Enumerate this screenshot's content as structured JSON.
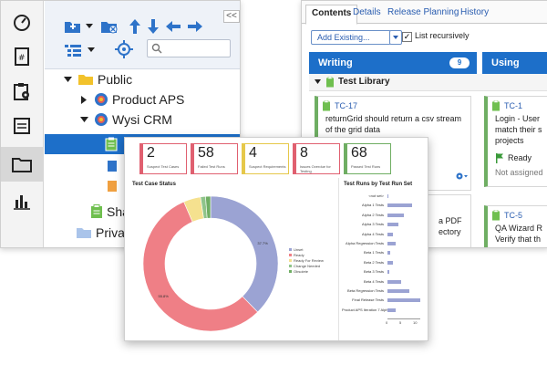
{
  "tree": {
    "collapse": "<<",
    "items": [
      {
        "label": "Public"
      },
      {
        "label": "Product APS"
      },
      {
        "label": "Wysi CRM"
      },
      {
        "label": ""
      },
      {
        "label": ""
      },
      {
        "label": ""
      },
      {
        "label": "Sha"
      },
      {
        "label": "Private"
      }
    ]
  },
  "rail": {
    "icons": [
      "dashboard-icon",
      "requirements-icon",
      "settings-clipboard-icon",
      "test-list-icon",
      "folder-icon",
      "reports-icon"
    ]
  },
  "right": {
    "tabs": [
      "Contents",
      "Details",
      "Release Planning",
      "History"
    ],
    "add_existing": "Add Existing...",
    "list_recursively": "List recursively",
    "columns": [
      {
        "name": "Writing",
        "count": "9"
      },
      {
        "name": "Using"
      }
    ],
    "library": "Test Library",
    "cards": [
      {
        "id": "TC-17",
        "text": [
          "returnGrid should return a csv stream",
          "of the grid data"
        ]
      },
      {
        "id": "TC-1",
        "text": [
          "Login - User",
          "match their s",
          "projects"
        ],
        "status": "Ready",
        "assignee": "Not assigned"
      },
      {
        "id": "",
        "text": [
          "a PDF",
          "ectory"
        ]
      },
      {
        "id": "TC-5",
        "text": [
          "QA Wizard R",
          "Verify that th"
        ]
      }
    ]
  },
  "dash": {
    "stats": [
      {
        "num": "2",
        "cap": "Suspect Test Cases",
        "color": "#e06070"
      },
      {
        "num": "58",
        "cap": "Failed Test Runs",
        "color": "#e06070"
      },
      {
        "num": "4",
        "cap": "Suspect Requirements",
        "color": "#e6c84a"
      },
      {
        "num": "8",
        "cap": "Issues Overdue for Testing",
        "color": "#e06070"
      },
      {
        "num": "68",
        "cap": "Passed Test Runs",
        "color": "#6fae63"
      }
    ],
    "status_title": "Test Case Status",
    "runs_title": "Test Runs by Test Run Set"
  },
  "chart_data": [
    {
      "type": "pie",
      "title": "Test Case Status",
      "categories": [
        "Unset",
        "Ready",
        "Ready For Review",
        "Change Needed",
        "Obsolete"
      ],
      "values": [
        37.7,
        55.8,
        4.1,
        1.2,
        1.2
      ],
      "colors": [
        "#9ba3d3",
        "#ef7f86",
        "#f5e18f",
        "#8fc48a",
        "#6fae63"
      ],
      "legend": "right"
    },
    {
      "type": "bar",
      "title": "Test Runs by Test Run Set",
      "categories": [
        "<not set>",
        "Alpha 1 Tests",
        "Alpha 2 Tests",
        "Alpha 3 Tests",
        "Alpha 4 Tests",
        "Alpha Regression Tests",
        "Beta 1 Tests",
        "Beta 2 Tests",
        "Beta 3 Tests",
        "Beta 4 Tests",
        "Beta Regression Tests",
        "Final Release Tests",
        "Product APS Iteration 7 Alpha"
      ],
      "values": [
        0.4,
        9,
        6,
        4,
        2,
        3,
        1,
        2,
        0.8,
        5,
        8,
        12,
        3
      ],
      "xticks": [
        "0",
        "5",
        "10"
      ],
      "xlim": [
        0,
        12
      ]
    }
  ]
}
